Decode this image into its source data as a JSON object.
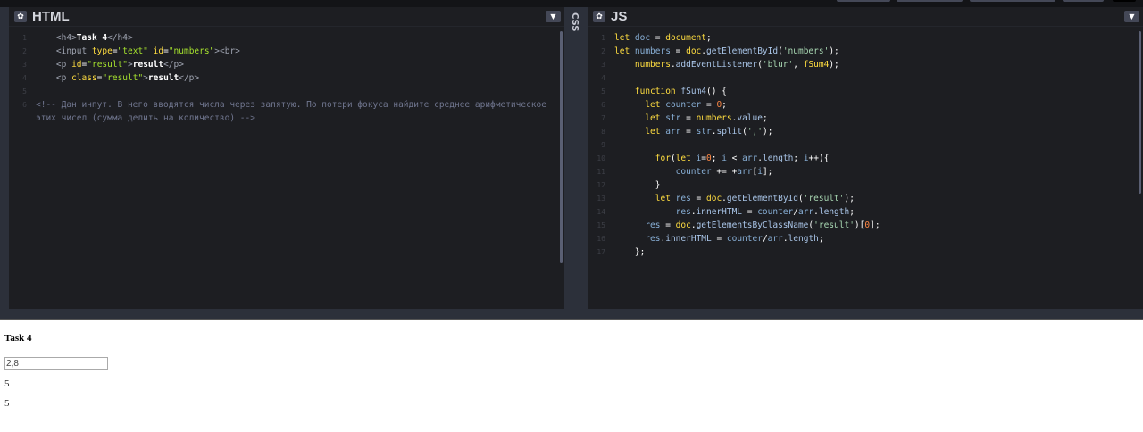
{
  "html_panel": {
    "title": "HTML",
    "lines": [
      [
        [
          "    ",
          "p"
        ],
        [
          "<h4>",
          "tag"
        ],
        [
          "Task 4",
          "b"
        ],
        [
          "</h4>",
          "tag"
        ]
      ],
      [
        [
          "    ",
          "p"
        ],
        [
          "<input ",
          "tag"
        ],
        [
          "type",
          "attr"
        ],
        [
          "=",
          "p"
        ],
        [
          "\"text\"",
          "str"
        ],
        [
          " ",
          "p"
        ],
        [
          "id",
          "attr"
        ],
        [
          "=",
          "p"
        ],
        [
          "\"numbers\"",
          "str"
        ],
        [
          "><br>",
          "tag"
        ]
      ],
      [
        [
          "    ",
          "p"
        ],
        [
          "<p ",
          "tag"
        ],
        [
          "id",
          "attr"
        ],
        [
          "=",
          "p"
        ],
        [
          "\"result\"",
          "str"
        ],
        [
          ">",
          "tag"
        ],
        [
          "result",
          "b"
        ],
        [
          "</p>",
          "tag"
        ]
      ],
      [
        [
          "    ",
          "p"
        ],
        [
          "<p ",
          "tag"
        ],
        [
          "class",
          "attr"
        ],
        [
          "=",
          "p"
        ],
        [
          "\"result\"",
          "str"
        ],
        [
          ">",
          "tag"
        ],
        [
          "result",
          "b"
        ],
        [
          "</p>",
          "tag"
        ]
      ],
      [],
      [
        [
          "<!-- Дан инпут. В него вводятся числа через запятую. По потери фокуса найдите среднее арифметическое этих чисел (сумма делить на количество) -->",
          "cmt"
        ]
      ]
    ]
  },
  "css_panel": {
    "title": "CSS"
  },
  "js_panel": {
    "title": "JS",
    "lines": [
      [
        [
          "let ",
          "kw"
        ],
        [
          "doc",
          "var"
        ],
        [
          " = ",
          "p"
        ],
        [
          "document",
          "obj"
        ],
        [
          ";",
          "p"
        ]
      ],
      [
        [
          "let ",
          "kw"
        ],
        [
          "numbers",
          "var"
        ],
        [
          " = ",
          "p"
        ],
        [
          "doc",
          "obj"
        ],
        [
          ".",
          "p"
        ],
        [
          "getElementById",
          "fn"
        ],
        [
          "(",
          "p"
        ],
        [
          "'numbers'",
          "s2"
        ],
        [
          ");",
          "p"
        ]
      ],
      [
        [
          "    ",
          "p"
        ],
        [
          "numbers",
          "obj"
        ],
        [
          ".",
          "p"
        ],
        [
          "addEventListener",
          "fn"
        ],
        [
          "(",
          "p"
        ],
        [
          "'blur'",
          "s2"
        ],
        [
          ", ",
          "p"
        ],
        [
          "fSum4",
          "obj"
        ],
        [
          ");",
          "p"
        ]
      ],
      [],
      [
        [
          "    ",
          "p"
        ],
        [
          "function ",
          "kw"
        ],
        [
          "fSum4",
          "fn"
        ],
        [
          "() {",
          "p"
        ]
      ],
      [
        [
          "      ",
          "p"
        ],
        [
          "let ",
          "kw"
        ],
        [
          "counter",
          "var"
        ],
        [
          " = ",
          "p"
        ],
        [
          "0",
          "num0"
        ],
        [
          ";",
          "p"
        ]
      ],
      [
        [
          "      ",
          "p"
        ],
        [
          "let ",
          "kw"
        ],
        [
          "str",
          "var"
        ],
        [
          " = ",
          "p"
        ],
        [
          "numbers",
          "obj"
        ],
        [
          ".",
          "p"
        ],
        [
          "value",
          "fn"
        ],
        [
          ";",
          "p"
        ]
      ],
      [
        [
          "      ",
          "p"
        ],
        [
          "let ",
          "kw"
        ],
        [
          "arr",
          "var"
        ],
        [
          " = ",
          "p"
        ],
        [
          "str",
          "var"
        ],
        [
          ".",
          "p"
        ],
        [
          "split",
          "fn"
        ],
        [
          "(",
          "p"
        ],
        [
          "','",
          "s2"
        ],
        [
          ");",
          "p"
        ]
      ],
      [],
      [
        [
          "        ",
          "p"
        ],
        [
          "for",
          "kw"
        ],
        [
          "(",
          "p"
        ],
        [
          "let ",
          "kw"
        ],
        [
          "i",
          "var"
        ],
        [
          "=",
          "p"
        ],
        [
          "0",
          "num0"
        ],
        [
          "; ",
          "p"
        ],
        [
          "i",
          "var"
        ],
        [
          " < ",
          "p"
        ],
        [
          "arr",
          "var"
        ],
        [
          ".",
          "p"
        ],
        [
          "length",
          "fn"
        ],
        [
          "; ",
          "p"
        ],
        [
          "i",
          "var"
        ],
        [
          "++){",
          "p"
        ]
      ],
      [
        [
          "            ",
          "p"
        ],
        [
          "counter",
          "var"
        ],
        [
          " += +",
          "p"
        ],
        [
          "arr",
          "var"
        ],
        [
          "[",
          "p"
        ],
        [
          "i",
          "var"
        ],
        [
          "];",
          "p"
        ]
      ],
      [
        [
          "        ",
          "p"
        ],
        [
          "}",
          "p"
        ]
      ],
      [
        [
          "        ",
          "p"
        ],
        [
          "let ",
          "kw"
        ],
        [
          "res",
          "var"
        ],
        [
          " = ",
          "p"
        ],
        [
          "doc",
          "obj"
        ],
        [
          ".",
          "p"
        ],
        [
          "getElementById",
          "fn"
        ],
        [
          "(",
          "p"
        ],
        [
          "'result'",
          "s2"
        ],
        [
          ");",
          "p"
        ]
      ],
      [
        [
          "            ",
          "p"
        ],
        [
          "res",
          "var"
        ],
        [
          ".",
          "p"
        ],
        [
          "innerHTML",
          "fn"
        ],
        [
          " = ",
          "p"
        ],
        [
          "counter",
          "var"
        ],
        [
          "/",
          "p"
        ],
        [
          "arr",
          "var"
        ],
        [
          ".",
          "p"
        ],
        [
          "length",
          "fn"
        ],
        [
          ";",
          "p"
        ]
      ],
      [
        [
          "      ",
          "p"
        ],
        [
          "res",
          "var"
        ],
        [
          " = ",
          "p"
        ],
        [
          "doc",
          "obj"
        ],
        [
          ".",
          "p"
        ],
        [
          "getElementsByClassName",
          "fn"
        ],
        [
          "(",
          "p"
        ],
        [
          "'result'",
          "s2"
        ],
        [
          ")[",
          "p"
        ],
        [
          "0",
          "num0"
        ],
        [
          "];",
          "p"
        ]
      ],
      [
        [
          "      ",
          "p"
        ],
        [
          "res",
          "var"
        ],
        [
          ".",
          "p"
        ],
        [
          "innerHTML",
          "fn"
        ],
        [
          " = ",
          "p"
        ],
        [
          "counter",
          "var"
        ],
        [
          "/",
          "p"
        ],
        [
          "arr",
          "var"
        ],
        [
          ".",
          "p"
        ],
        [
          "length",
          "fn"
        ],
        [
          ";",
          "p"
        ]
      ],
      [
        [
          "    ",
          "p"
        ],
        [
          "};",
          "p"
        ]
      ]
    ]
  },
  "output": {
    "heading": "Task 4",
    "input_value": "2,8",
    "result1": "5",
    "result2": "5"
  }
}
